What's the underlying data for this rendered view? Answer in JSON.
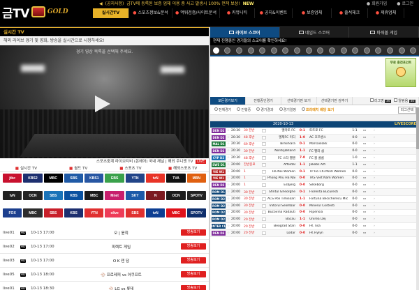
{
  "logo": {
    "main": "금TV",
    "sub": "GOLD"
  },
  "notice": {
    "prefix": "(공지사항)",
    "text": "금TV에 등록된 보증 업체 이용 중 사고 발생시 100% 먼저 보상!",
    "new": "NEW"
  },
  "auth": {
    "signup": "회원가입",
    "login": "로그인"
  },
  "nav": [
    {
      "label": "실시간TV",
      "active": true
    },
    {
      "label": "스포츠정보&분석",
      "active": false
    },
    {
      "label": "먹튀검증/사이트분석",
      "active": false
    },
    {
      "label": "커뮤니티",
      "active": false
    },
    {
      "label": "공지&이벤트",
      "active": false
    },
    {
      "label": "보증업체",
      "active": false
    },
    {
      "label": "출석체크",
      "active": false
    },
    {
      "label": "제휴업체",
      "active": false
    }
  ],
  "left": {
    "title": "실시간 TV",
    "subtitle": "해외 라이브 경기 및 영화, 방송을 실시간으로 시청하세요!",
    "video_msg": "경기 영상 목록을 선택해 주세요.",
    "video_bar": "스포츠중계 라이브티비 (온에어) 국내 채널 | 해외 주니엔 TV",
    "video_btn": "LIVE",
    "categories": [
      "실시간 TV",
      "월드 TV",
      "스포츠 TV",
      "해외스포츠 TV"
    ],
    "channels": [
      {
        "name": "jtbc",
        "color": "#c8102e"
      },
      {
        "name": "KBS2",
        "color": "#1d2f6f"
      },
      {
        "name": "MBC",
        "color": "#000000"
      },
      {
        "name": "SBS",
        "color": "#1f5aa6"
      },
      {
        "name": "KBS1",
        "color": "#2756a2"
      },
      {
        "name": "EBS",
        "color": "#3aa14b"
      },
      {
        "name": "YTN",
        "color": "#224488"
      },
      {
        "name": "tvN",
        "color": "#e83326"
      },
      {
        "name": "TVA",
        "color": "#111111"
      },
      {
        "name": "MBN",
        "color": "#e06010"
      },
      {
        "name": "tvN",
        "color": "#222222"
      },
      {
        "name": "OCN",
        "color": "#222222"
      },
      {
        "name": "SBS",
        "color": "#1a73b8"
      },
      {
        "name": "KBS",
        "color": "#0a51a0"
      },
      {
        "name": "MBC",
        "color": "#1b1b1b"
      },
      {
        "name": "Mnet",
        "color": "#c71e6c"
      },
      {
        "name": "SKY",
        "color": "#1c5aa8"
      },
      {
        "name": "N",
        "color": "#7c1a20"
      },
      {
        "name": "OCN",
        "color": "#1c1c1c"
      },
      {
        "name": "SPOTV",
        "color": "#222222"
      },
      {
        "name": "FOX",
        "color": "#1c3f8e"
      },
      {
        "name": "MBC",
        "color": "#2d2d2d"
      },
      {
        "name": "SBS",
        "color": "#c81f2a"
      },
      {
        "name": "KBS",
        "color": "#1d2f6f"
      },
      {
        "name": "YTN",
        "color": "#e03030"
      },
      {
        "name": "olive",
        "color": "#ee3c58"
      },
      {
        "name": "SBS",
        "color": "#e0302f"
      },
      {
        "name": "tvN",
        "color": "#0d3e92"
      },
      {
        "name": "MBC",
        "color": "#e0121b"
      },
      {
        "name": "SPOTV",
        "color": "#0e2e6b"
      }
    ],
    "list": [
      {
        "id": "live01",
        "time": "10-13 17:00",
        "match": "오 | 윤희",
        "sport": "",
        "btn": "방송보기"
      },
      {
        "id": "live02",
        "time": "10-13 17:00",
        "match": "피렉트 게임",
        "sport": "",
        "btn": "방송보기"
      },
      {
        "id": "live03",
        "time": "10-13 17:00",
        "match": "O K 덴 담",
        "sport": "",
        "btn": "방송보기"
      },
      {
        "id": "live05",
        "time": "10-13 18:00",
        "match": "프로레피 vs 아쿠프트",
        "sport": "⚾",
        "btn": "방송보기"
      },
      {
        "id": "live01",
        "time": "10-13 18:30",
        "match": "LG vs 롯데",
        "sport": "⚾",
        "btn": "방송보기"
      }
    ]
  },
  "right": {
    "tabs": [
      {
        "label": "라이브 스코어",
        "active": true
      },
      {
        "label": "네임드 스코어",
        "active": false
      },
      {
        "label": "파워볼 게임",
        "active": false
      }
    ],
    "subtitle": "현재 진행중인 경기들의 스코어를 확인하세요!",
    "ad_text": "무료 충전포인트",
    "subtabs": [
      {
        "label": "모든경기보기",
        "active": true
      },
      {
        "label": "진행중인경기",
        "active": false
      },
      {
        "label": "선택경기만 보기",
        "active": false
      },
      {
        "label": "선택경기만 감추기",
        "active": false
      }
    ],
    "opts": [
      {
        "label": "리그명",
        "val": "3s"
      },
      {
        "label": "알림음",
        "val": "3s"
      }
    ],
    "filters": [
      "전체경기",
      "진행중",
      "경기결과",
      "경기일정",
      "프리매치 배당 보기"
    ],
    "filter_sel": "리그선택",
    "date": "2020-10-13",
    "livescore": "LIVESCORE",
    "games": [
      {
        "lg": "DEN D2",
        "lc": "#7e2a9a",
        "t": "20:30",
        "st": "30 전반",
        "h": "엘마토 FC",
        "sc": "0-1",
        "a": "토트로 FC",
        "ht": "1-1"
      },
      {
        "lg": "DEN D2",
        "lc": "#7e2a9a",
        "t": "20:30",
        "st": "48 후반",
        "h": "엘제FC 미디",
        "sc": "1-0",
        "a": "AC 호르센스",
        "ht": "0-0"
      },
      {
        "lg": "MAL D1",
        "lc": "#1b7a3a",
        "t": "20:30",
        "st": "69 후반",
        "h": "Birkirkara",
        "sc": "0-1",
        "a": "Marsaxlokk",
        "ht": "0-0"
      },
      {
        "lg": "DEN D2",
        "lc": "#7e2a9a",
        "t": "20:30",
        "st": "30 전반",
        "h": "Nordsjælland",
        "sc": "1-1",
        "a": "FC 멜리 섬",
        "ht": "0-0"
      },
      {
        "lg": "CYP D2",
        "lc": "#1a6fb0",
        "t": "20:30",
        "st": "48 후반",
        "h": "FC 스타 멜렌",
        "sc": "7-0",
        "a": "FC 볼 콜롬",
        "ht": "1-0"
      },
      {
        "lg": "SWE D1",
        "lc": "#1b7a3a",
        "t": "20:00",
        "st": "전반종료",
        "h": "Affeldal",
        "sc": "1-1",
        "a": "Jakobs Alfi",
        "ht": "1-1"
      },
      {
        "lg": "VIE W1",
        "lc": "#b52020",
        "t": "20:00",
        "st": "1",
        "h": "Ha Noi Women",
        "sc": "0-1",
        "a": "TP Ho Chi Minh Women",
        "ht": "0-0"
      },
      {
        "lg": "VIE W1",
        "lc": "#b52020",
        "t": "20:00",
        "st": "1",
        "h": "Phong Phu Ha Nam",
        "sc": "0-0",
        "a": "TKS Viet Nam Women",
        "ht": "0-0"
      },
      {
        "lg": "DEN D2",
        "lc": "#7e2a9a",
        "t": "20:00",
        "st": "1",
        "h": "Esbjerg",
        "sc": "0-0",
        "a": "Silkeborg",
        "ht": "0-0"
      },
      {
        "lg": "ROM D1",
        "lc": "#0d4576",
        "t": "20:00",
        "st": "30 전반",
        "h": "Sfintul Gheorghe",
        "sc": "0-1",
        "a": "Florenta Bucuresti",
        "ht": "0-0"
      },
      {
        "lg": "ROM D2",
        "lc": "#0d4576",
        "t": "20:00",
        "st": "30 전반",
        "h": "ACS Poli Timisoara",
        "sc": "1-1",
        "a": "Fortuna Becicherecu Mic",
        "ht": "0-0"
      },
      {
        "lg": "ROM D2",
        "lc": "#0d4576",
        "t": "20:00",
        "st": "30 전반",
        "h": "Viitorul Selimbar",
        "sc": "0-0",
        "a": "Minerul Costesti",
        "ht": "0-0"
      },
      {
        "lg": "ROM D2",
        "lc": "#0d4576",
        "t": "20:00",
        "st": "30 전반",
        "h": "Bucovina Radauti",
        "sc": "0-0",
        "a": "Ripensia",
        "ht": "0-0"
      },
      {
        "lg": "ROM D2",
        "lc": "#0d4576",
        "t": "20:00",
        "st": "20 전반",
        "h": "Bacau",
        "sc": "1-1",
        "a": "Unirea Dej",
        "ht": "0-0"
      },
      {
        "lg": "INTER CLUB",
        "lc": "#0d4576",
        "t": "20:00",
        "st": "20 전반",
        "h": "Beograd Stari",
        "sc": "0-0",
        "a": "FK Tisa",
        "ht": "0-0"
      },
      {
        "lg": "DEN D3",
        "lc": "#7e2a9a",
        "t": "20:00",
        "st": "20 전반",
        "h": "Lodar",
        "sc": "0-0",
        "a": "FK Hylyn",
        "ht": "0-0"
      }
    ]
  }
}
